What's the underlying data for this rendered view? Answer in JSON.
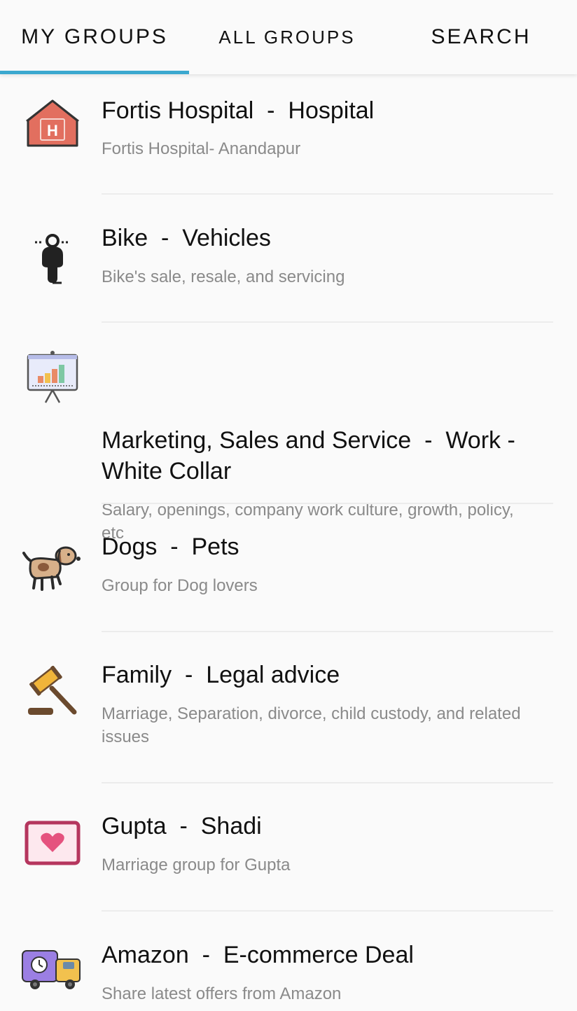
{
  "tabs": [
    {
      "label": "MY GROUPS",
      "active": true
    },
    {
      "label": "ALL GROUPS",
      "active": false
    },
    {
      "label": "SEARCH",
      "active": false
    }
  ],
  "accent_color": "#3ba8cf",
  "groups": [
    {
      "title": "Fortis Hospital  -  Hospital",
      "description": "Fortis Hospital- Anandapur",
      "icon": "hospital-icon"
    },
    {
      "title": "Bike  -  Vehicles",
      "description": "Bike's sale, resale, and servicing",
      "icon": "bike-icon"
    },
    {
      "title": "Marketing, Sales and Service  -  Work - White Collar",
      "description": "Salary, openings, company work culture, growth, policy, etc",
      "icon": "presentation-chart-icon"
    },
    {
      "title": "Dogs  -  Pets",
      "description": "Group for Dog lovers",
      "icon": "dog-icon"
    },
    {
      "title": "Family  -  Legal advice",
      "description": "Marriage, Separation, divorce, child custody, and related issues",
      "icon": "gavel-icon"
    },
    {
      "title": "Gupta  -  Shadi",
      "description": "Marriage group for Gupta",
      "icon": "heart-frame-icon"
    },
    {
      "title": "Amazon  -  E-commerce Deal",
      "description": "Share latest offers from Amazon",
      "icon": "delivery-truck-icon"
    }
  ]
}
